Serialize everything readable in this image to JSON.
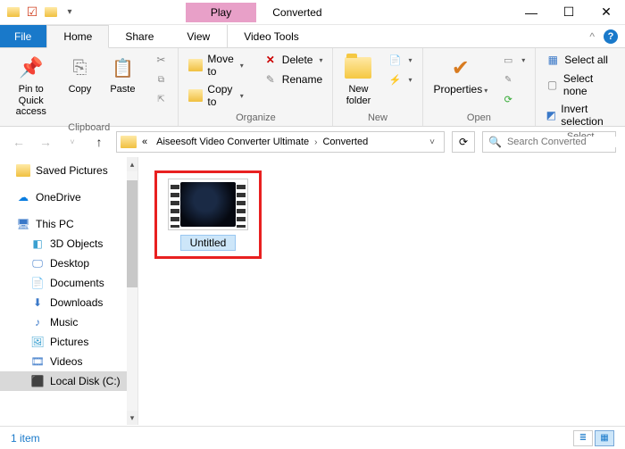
{
  "title": "Converted",
  "play_label": "Play",
  "tabs": {
    "file": "File",
    "home": "Home",
    "share": "Share",
    "view": "View",
    "video_tools": "Video Tools"
  },
  "ribbon": {
    "clipboard": {
      "label": "Clipboard",
      "pin": "Pin to Quick access",
      "copy": "Copy",
      "paste": "Paste"
    },
    "organize": {
      "label": "Organize",
      "move": "Move to",
      "copy": "Copy to",
      "del": "Delete",
      "rename": "Rename"
    },
    "new": {
      "label": "New",
      "new_folder": "New folder"
    },
    "open": {
      "label": "Open",
      "properties": "Properties"
    },
    "select": {
      "label": "Select",
      "all": "Select all",
      "none": "Select none",
      "invert": "Invert selection"
    }
  },
  "breadcrumbs": [
    "Aiseesoft Video Converter Ultimate",
    "Converted"
  ],
  "search_placeholder": "Search Converted",
  "tree": {
    "saved_pictures": "Saved Pictures",
    "onedrive": "OneDrive",
    "this_pc": "This PC",
    "3d": "3D Objects",
    "desktop": "Desktop",
    "documents": "Documents",
    "downloads": "Downloads",
    "music": "Music",
    "pictures": "Pictures",
    "videos": "Videos",
    "local_c": "Local Disk (C:)"
  },
  "file": {
    "name": "Untitled"
  },
  "status": "1 item"
}
